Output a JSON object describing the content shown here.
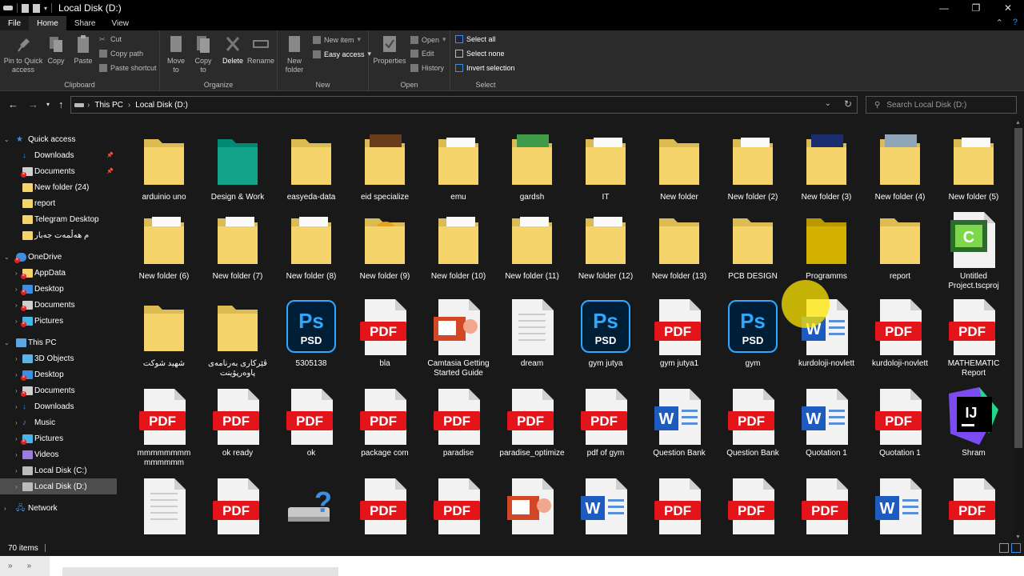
{
  "window": {
    "title": "Local Disk (D:)"
  },
  "ribbon_tabs": [
    "File",
    "Home",
    "Share",
    "View"
  ],
  "ribbon": {
    "clipboard": {
      "label": "Clipboard",
      "pin": "Pin to Quick access",
      "copy": "Copy",
      "paste": "Paste",
      "cut": "Cut",
      "copy_path": "Copy path",
      "paste_shortcut": "Paste shortcut"
    },
    "organize": {
      "label": "Organize",
      "move_to": "Move to",
      "copy_to": "Copy to",
      "delete": "Delete",
      "rename": "Rename"
    },
    "new": {
      "label": "New",
      "new_folder": "New folder",
      "new_item": "New item",
      "easy_access": "Easy access"
    },
    "open": {
      "label": "Open",
      "properties": "Properties",
      "open": "Open",
      "edit": "Edit",
      "history": "History"
    },
    "select": {
      "label": "Select",
      "select_all": "Select all",
      "select_none": "Select none",
      "invert": "Invert selection"
    }
  },
  "address": {
    "crumbs": [
      "This PC",
      "Local Disk (D:)"
    ],
    "search_placeholder": "Search Local Disk (D:)"
  },
  "nav": [
    {
      "label": "Quick access",
      "icon": "star-icon",
      "level": 0,
      "arrow": "open",
      "pinned": false,
      "x": false
    },
    {
      "label": "Downloads",
      "icon": "download-icon",
      "level": 1,
      "arrow": "",
      "pinned": true,
      "x": false
    },
    {
      "label": "Documents",
      "icon": "document-icon",
      "level": 1,
      "arrow": "",
      "pinned": true,
      "x": true
    },
    {
      "label": "New folder (24)",
      "icon": "folder-icon",
      "level": 1,
      "arrow": "",
      "pinned": false,
      "x": false
    },
    {
      "label": "report",
      "icon": "folder-icon",
      "level": 1,
      "arrow": "",
      "pinned": false,
      "x": false
    },
    {
      "label": "Telegram Desktop",
      "icon": "folder-icon",
      "level": 1,
      "arrow": "",
      "pinned": false,
      "x": false
    },
    {
      "label": "م هەڵمەت جەبار",
      "icon": "folder-icon",
      "level": 1,
      "arrow": "",
      "pinned": false,
      "x": false
    },
    {
      "label": "OneDrive",
      "icon": "cloud-icon",
      "level": 0,
      "arrow": "open",
      "pinned": false,
      "x": true
    },
    {
      "label": "AppData",
      "icon": "folder-icon",
      "level": 1,
      "arrow": "closed",
      "pinned": false,
      "x": true
    },
    {
      "label": "Desktop",
      "icon": "desktop-icon",
      "level": 1,
      "arrow": "closed",
      "pinned": false,
      "x": true
    },
    {
      "label": "Documents",
      "icon": "document-icon",
      "level": 1,
      "arrow": "closed",
      "pinned": false,
      "x": true
    },
    {
      "label": "Pictures",
      "icon": "picture-icon",
      "level": 1,
      "arrow": "closed",
      "pinned": false,
      "x": true
    },
    {
      "label": "This PC",
      "icon": "computer-icon",
      "level": 0,
      "arrow": "open",
      "pinned": false,
      "x": false
    },
    {
      "label": "3D Objects",
      "icon": "cube-icon",
      "level": 1,
      "arrow": "closed",
      "pinned": false,
      "x": false
    },
    {
      "label": "Desktop",
      "icon": "desktop-icon",
      "level": 1,
      "arrow": "closed",
      "pinned": false,
      "x": true
    },
    {
      "label": "Documents",
      "icon": "document-icon",
      "level": 1,
      "arrow": "closed",
      "pinned": false,
      "x": true
    },
    {
      "label": "Downloads",
      "icon": "download-icon",
      "level": 1,
      "arrow": "closed",
      "pinned": false,
      "x": false
    },
    {
      "label": "Music",
      "icon": "music-icon",
      "level": 1,
      "arrow": "closed",
      "pinned": false,
      "x": false
    },
    {
      "label": "Pictures",
      "icon": "picture-icon",
      "level": 1,
      "arrow": "closed",
      "pinned": false,
      "x": true
    },
    {
      "label": "Videos",
      "icon": "video-icon",
      "level": 1,
      "arrow": "closed",
      "pinned": false,
      "x": false
    },
    {
      "label": "Local Disk (C:)",
      "icon": "drive-icon",
      "level": 1,
      "arrow": "closed",
      "pinned": false,
      "x": false
    },
    {
      "label": "Local Disk (D:)",
      "icon": "drive-icon",
      "level": 1,
      "arrow": "closed",
      "pinned": false,
      "x": false,
      "selected": true
    },
    {
      "label": "Network",
      "icon": "network-icon",
      "level": 0,
      "arrow": "closed",
      "pinned": false,
      "x": false
    }
  ],
  "files": [
    {
      "name": "arduinio uno",
      "type": "folder"
    },
    {
      "name": "Design & Work",
      "type": "folder-teal"
    },
    {
      "name": "easyeda-data",
      "type": "folder"
    },
    {
      "name": "eid specialize",
      "type": "folder-photo"
    },
    {
      "name": "emu",
      "type": "folder-docs"
    },
    {
      "name": "gardsh",
      "type": "folder-green"
    },
    {
      "name": "IT",
      "type": "folder-pdf"
    },
    {
      "name": "New folder",
      "type": "folder"
    },
    {
      "name": "New folder (2)",
      "type": "folder-pdf"
    },
    {
      "name": "New folder (3)",
      "type": "folder-blue"
    },
    {
      "name": "New folder (4)",
      "type": "folder-photo2"
    },
    {
      "name": "New folder (5)",
      "type": "folder-red"
    },
    {
      "name": "New folder (6)",
      "type": "folder-word"
    },
    {
      "name": "New folder (7)",
      "type": "folder-pdf"
    },
    {
      "name": "New folder (8)",
      "type": "folder-word"
    },
    {
      "name": "New folder (9)",
      "type": "folder-fun"
    },
    {
      "name": "New folder (10)",
      "type": "folder-docs"
    },
    {
      "name": "New folder (11)",
      "type": "folder-docs"
    },
    {
      "name": "New folder (12)",
      "type": "folder-docs"
    },
    {
      "name": "New folder (13)",
      "type": "folder"
    },
    {
      "name": "PCB DESIGN",
      "type": "folder"
    },
    {
      "name": "Programms",
      "type": "folder-gold"
    },
    {
      "name": "report",
      "type": "folder"
    },
    {
      "name": "Untitled Project.tscproj",
      "type": "camtasia"
    },
    {
      "name": "شهید شوکت",
      "type": "folder"
    },
    {
      "name": "ڤێرکاری بەرنامەی پاوەرپۆینت",
      "type": "folder"
    },
    {
      "name": "5305138",
      "type": "psd"
    },
    {
      "name": "bla",
      "type": "pdf"
    },
    {
      "name": "Camtasia Getting Started Guide",
      "type": "ppt"
    },
    {
      "name": "dream",
      "type": "txt"
    },
    {
      "name": "gym jutya",
      "type": "psd"
    },
    {
      "name": "gym jutya1",
      "type": "pdf"
    },
    {
      "name": "gym",
      "type": "psd"
    },
    {
      "name": "kurdoloji-novlett",
      "type": "word"
    },
    {
      "name": "kurdoloji-novlett",
      "type": "pdf"
    },
    {
      "name": "MATHEMATIC Report",
      "type": "pdf"
    },
    {
      "name": "mmmmmmmm mmmmmm",
      "type": "pdf"
    },
    {
      "name": "ok ready",
      "type": "pdf"
    },
    {
      "name": "ok",
      "type": "pdf"
    },
    {
      "name": "package com",
      "type": "pdf"
    },
    {
      "name": "paradise",
      "type": "pdf"
    },
    {
      "name": "paradise_optimize",
      "type": "pdf"
    },
    {
      "name": "pdf of gym",
      "type": "pdf"
    },
    {
      "name": "Question Bank",
      "type": "word"
    },
    {
      "name": "Question Bank",
      "type": "pdf"
    },
    {
      "name": "Quotation 1",
      "type": "word"
    },
    {
      "name": "Quotation 1",
      "type": "pdf"
    },
    {
      "name": "Shram",
      "type": "intellij"
    },
    {
      "name": "",
      "type": "txt"
    },
    {
      "name": "",
      "type": "pdf"
    },
    {
      "name": "",
      "type": "usb"
    },
    {
      "name": "",
      "type": "pdf"
    },
    {
      "name": "",
      "type": "pdf"
    },
    {
      "name": "",
      "type": "ppt"
    },
    {
      "name": "",
      "type": "word"
    },
    {
      "name": "",
      "type": "pdf"
    },
    {
      "name": "",
      "type": "pdf"
    },
    {
      "name": "",
      "type": "pdf"
    },
    {
      "name": "",
      "type": "word"
    },
    {
      "name": "",
      "type": "pdf"
    }
  ],
  "status": {
    "count": "70 items"
  },
  "colors": {
    "folder": "#f5d46b",
    "pdf": "#e3151b",
    "word": "#1e5bbf",
    "psd": "#31a8ff",
    "accent": "#3d8ee0"
  }
}
